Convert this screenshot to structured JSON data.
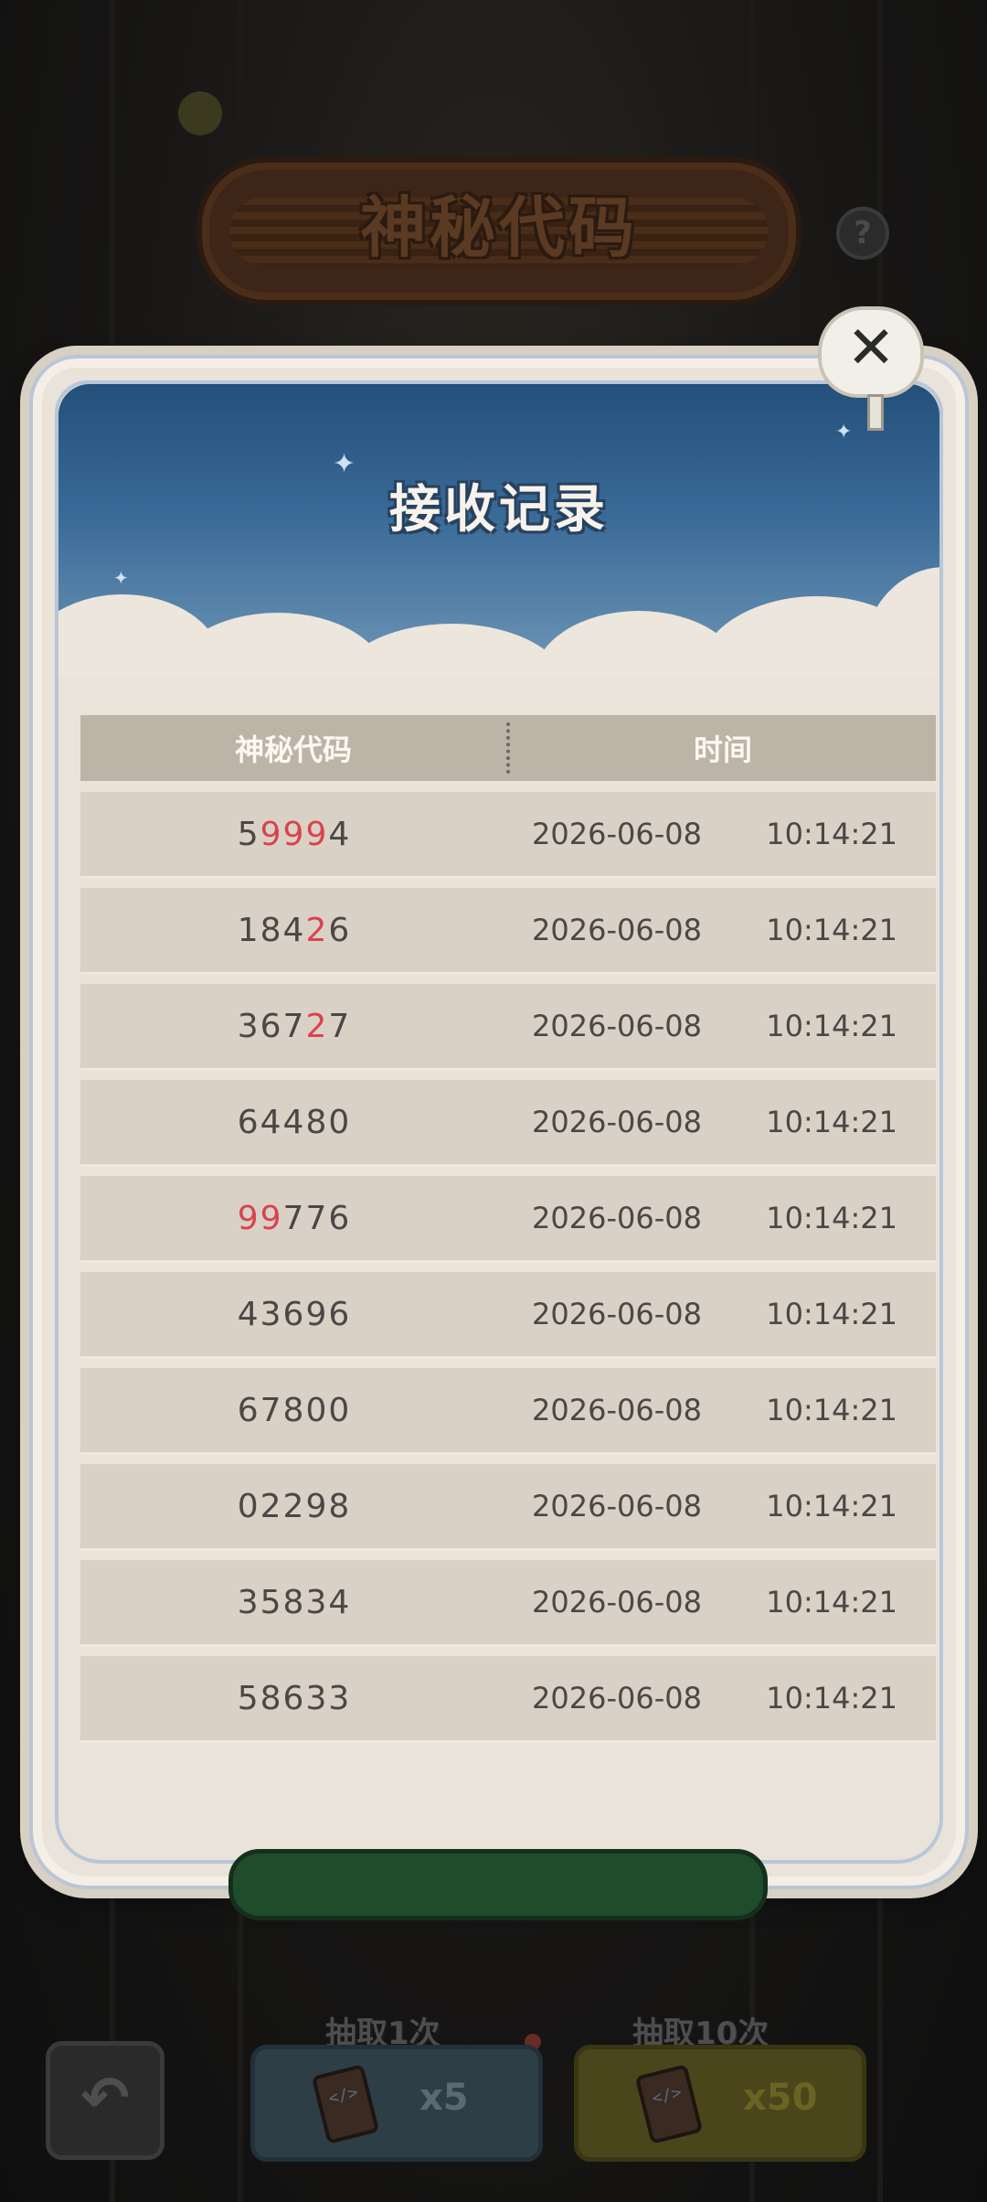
{
  "app": {
    "title": "神秘代码",
    "help_icon": "?",
    "close_icon": "✕"
  },
  "modal": {
    "title": "接收记录",
    "columns": [
      "神秘代码",
      "时间"
    ],
    "records": [
      {
        "code_parts": [
          {
            "t": "5",
            "hl": false
          },
          {
            "t": "999",
            "hl": true
          },
          {
            "t": "4",
            "hl": false
          }
        ],
        "date": "2026-06-08",
        "time": "10:14:21"
      },
      {
        "code_parts": [
          {
            "t": "184",
            "hl": false
          },
          {
            "t": "2",
            "hl": true
          },
          {
            "t": "6",
            "hl": false
          }
        ],
        "date": "2026-06-08",
        "time": "10:14:21"
      },
      {
        "code_parts": [
          {
            "t": "367",
            "hl": false
          },
          {
            "t": "2",
            "hl": true
          },
          {
            "t": "7",
            "hl": false
          }
        ],
        "date": "2026-06-08",
        "time": "10:14:21"
      },
      {
        "code_parts": [
          {
            "t": "64480",
            "hl": false
          }
        ],
        "date": "2026-06-08",
        "time": "10:14:21"
      },
      {
        "code_parts": [
          {
            "t": "99",
            "hl": true
          },
          {
            "t": "776",
            "hl": false
          }
        ],
        "date": "2026-06-08",
        "time": "10:14:21"
      },
      {
        "code_parts": [
          {
            "t": "43696",
            "hl": false
          }
        ],
        "date": "2026-06-08",
        "time": "10:14:21"
      },
      {
        "code_parts": [
          {
            "t": "67800",
            "hl": false
          }
        ],
        "date": "2026-06-08",
        "time": "10:14:21"
      },
      {
        "code_parts": [
          {
            "t": "02298",
            "hl": false
          }
        ],
        "date": "2026-06-08",
        "time": "10:14:21"
      },
      {
        "code_parts": [
          {
            "t": "35834",
            "hl": false
          }
        ],
        "date": "2026-06-08",
        "time": "10:14:21"
      },
      {
        "code_parts": [
          {
            "t": "58633",
            "hl": false
          }
        ],
        "date": "2026-06-08",
        "time": "10:14:21"
      }
    ]
  },
  "footer": {
    "back_icon": "↶",
    "draw_once": {
      "label": "抽取1次",
      "cost": "x5"
    },
    "draw_ten": {
      "label": "抽取10次",
      "cost": "x50"
    }
  },
  "colors": {
    "highlight": "#d9434e",
    "sky": "#2f5f8c",
    "panel": "#e9e3da"
  }
}
